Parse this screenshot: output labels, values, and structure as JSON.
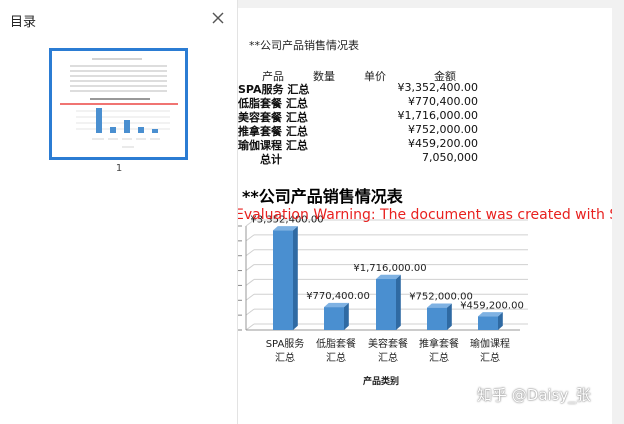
{
  "sidebar": {
    "title": "目录",
    "page_number": "1"
  },
  "sheet": {
    "title": "**公司产品销售情况表",
    "headers": {
      "product": "产品",
      "quantity": "数量",
      "unit_price": "单价",
      "amount": "金额"
    },
    "rows": [
      {
        "product": "SPA服务 汇总",
        "amount": "¥3,352,400.00"
      },
      {
        "product": "低脂套餐 汇总",
        "amount": "¥770,400.00"
      },
      {
        "product": "美容套餐 汇总",
        "amount": "¥1,716,000.00"
      },
      {
        "product": "推拿套餐 汇总",
        "amount": "¥752,000.00"
      },
      {
        "product": "瑜伽课程 汇总",
        "amount": "¥459,200.00"
      }
    ],
    "total": {
      "label": "总计",
      "amount": "7,050,000"
    }
  },
  "evaluation_warning": "Evaluation Warning: The document was created with  Spire.XLS for Python",
  "watermark": "知乎 @Daisy_张",
  "chart_data": {
    "type": "bar",
    "title": "**公司产品销售情况表",
    "categories": [
      "SPA服务\n汇总",
      "低脂套餐\n汇总",
      "美容套餐\n汇总",
      "推拿套餐\n汇总",
      "瑜伽课程\n汇总"
    ],
    "values": [
      3352400,
      770400,
      1716000,
      752000,
      459200
    ],
    "data_labels": [
      "¥3,352,400.00",
      "¥770,400.00",
      "¥1,716,000.00",
      "¥752,000.00",
      "¥459,200.00"
    ],
    "xlabel": "产品类别",
    "ylabel": "",
    "ylim": [
      0,
      3500000
    ],
    "grid": true,
    "legend": "none",
    "bar_color": "#4a8fd0",
    "bar_side_color": "#2f6aa3",
    "bar_top_color": "#7fb2e3"
  }
}
